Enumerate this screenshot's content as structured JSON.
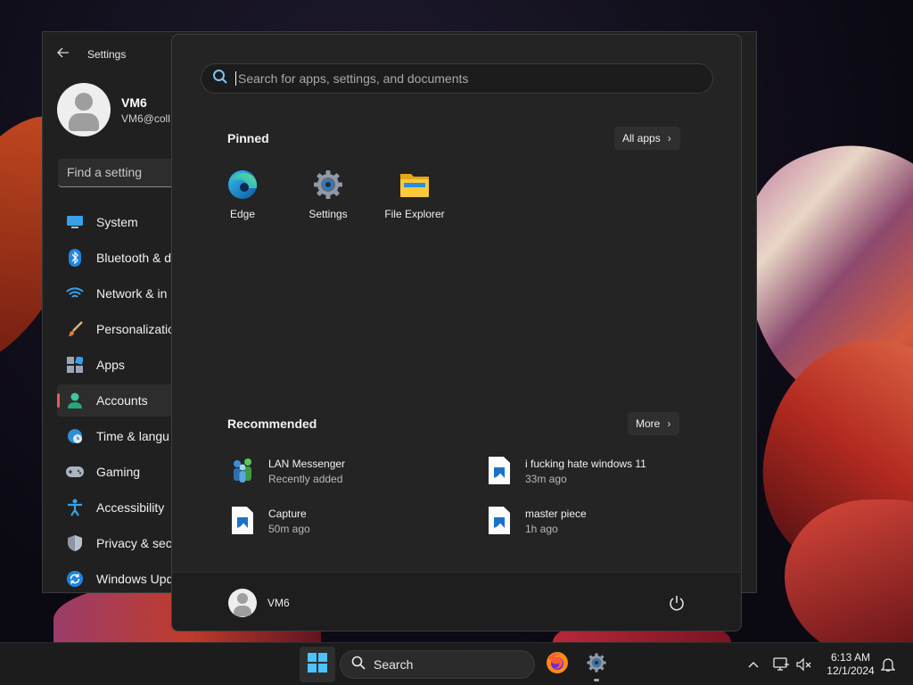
{
  "settings_window": {
    "title": "Settings",
    "user": {
      "name": "VM6",
      "email": "VM6@coll"
    },
    "find_placeholder": "Find a setting",
    "nav": [
      {
        "label": "System",
        "icon": "monitor-icon"
      },
      {
        "label": "Bluetooth & d",
        "icon": "bluetooth-icon"
      },
      {
        "label": "Network & in",
        "icon": "wifi-icon"
      },
      {
        "label": "Personalizatio",
        "icon": "brush-icon"
      },
      {
        "label": "Apps",
        "icon": "apps-icon"
      },
      {
        "label": "Accounts",
        "icon": "person-icon",
        "active": true
      },
      {
        "label": "Time & langu",
        "icon": "globe-clock-icon"
      },
      {
        "label": "Gaming",
        "icon": "gamepad-icon"
      },
      {
        "label": "Accessibility",
        "icon": "accessibility-icon"
      },
      {
        "label": "Privacy & secu",
        "icon": "shield-icon"
      },
      {
        "label": "Windows Upd",
        "icon": "update-icon"
      }
    ]
  },
  "start_menu": {
    "search_placeholder": "Search for apps, settings, and documents",
    "pinned": {
      "title": "Pinned",
      "all_apps_label": "All apps",
      "apps": [
        {
          "label": "Edge",
          "icon": "edge-icon"
        },
        {
          "label": "Settings",
          "icon": "settings-gear-icon"
        },
        {
          "label": "File Explorer",
          "icon": "folder-icon"
        }
      ]
    },
    "recommended": {
      "title": "Recommended",
      "more_label": "More",
      "items": [
        {
          "name": "LAN Messenger",
          "sub": "Recently added",
          "icon": "lan-messenger-icon"
        },
        {
          "name": "i fucking hate windows 11",
          "sub": "33m ago",
          "icon": "image-file-icon"
        },
        {
          "name": "Capture",
          "sub": "50m ago",
          "icon": "image-file-icon"
        },
        {
          "name": "master piece",
          "sub": "1h ago",
          "icon": "image-file-icon"
        }
      ]
    },
    "footer": {
      "user_name": "VM6"
    }
  },
  "taskbar": {
    "search_label": "Search",
    "pinned_apps": [
      "windows-start-icon",
      "firefox-icon",
      "settings-gear-icon"
    ],
    "tray": [
      "chevron-up-icon",
      "network-icon",
      "volume-muted-icon",
      "notification-bell-icon"
    ],
    "time": "6:13 AM",
    "date": "12/1/2024"
  },
  "colors": {
    "accent": "#0078d4",
    "active_indicator": "#e05a5a",
    "start_background": "#242424",
    "taskbar_background": "#1c1c1c"
  }
}
